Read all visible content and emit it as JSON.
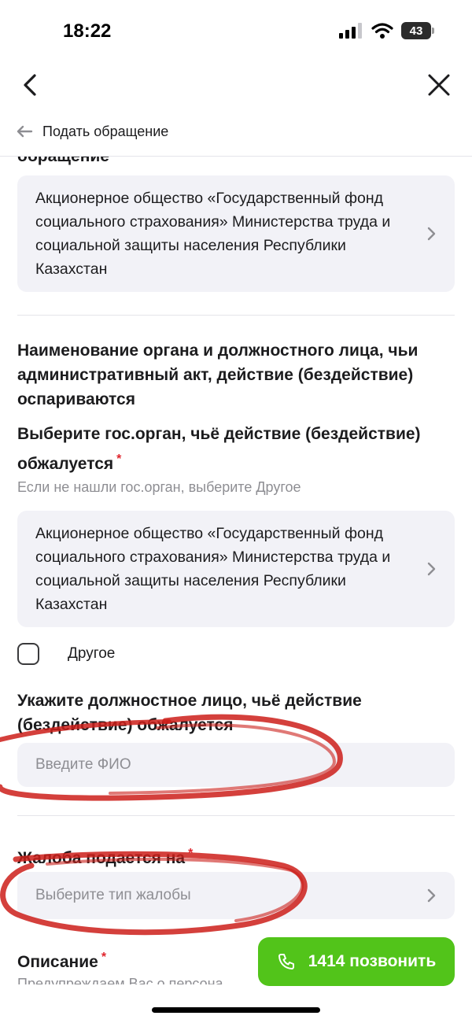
{
  "status_bar": {
    "time": "18:22",
    "battery": "43"
  },
  "nav": {
    "breadcrumb": "Подать обращение"
  },
  "form": {
    "clipped_section_title": "обращение",
    "top_selected_org": "Акционерное общество «Государственный фонд социального страхования» Министерства труда и социальной защиты населения Республики Казахстан",
    "section_title": "Наименование органа и должностного лица, чьи административный акт, действие (бездействие) оспариваются",
    "gov_org_label": "Выберите гос.орган, чьё действие (бездействие) обжалуется",
    "gov_org_hint": "Если не нашли гос.орган, выберите Другое",
    "gov_org_value": "Акционерное общество «Государственный фонд социального страхования» Министерства труда и социальной защиты населения Республики Казахстан",
    "other_checkbox_label": "Другое",
    "official_label": "Укажите должностное лицо, чьё действие (бездействие) обжалуется",
    "official_placeholder": "Введите ФИО",
    "complaint_label": "Жалоба подается на",
    "complaint_placeholder": "Выберите тип жалобы",
    "description_label": "Описание",
    "description_hint": "Предупреждаем Вас о персона",
    "required_mark": "*"
  },
  "call_button": {
    "label": "1414 позвонить"
  },
  "colors": {
    "accent_green": "#52c41a",
    "required_red": "#e0242c",
    "annotation_red": "#cc1f1a",
    "field_bg": "#f2f2f7"
  }
}
